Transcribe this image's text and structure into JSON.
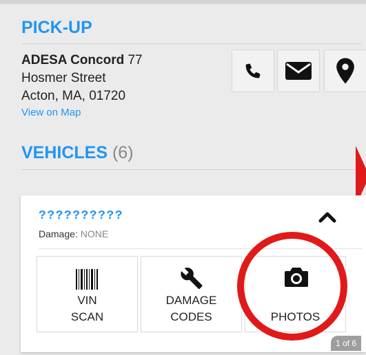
{
  "pickup": {
    "title": "PICK-UP",
    "location_name": "ADESA Concord",
    "address_line1_rest": "77",
    "address_line2": "Hosmer Street",
    "address_line3": "Acton, MA, 01720",
    "view_on_map": "View on Map",
    "actions": [
      {
        "icon": "phone-icon"
      },
      {
        "icon": "envelope-icon"
      },
      {
        "icon": "map-pin-icon"
      }
    ]
  },
  "vehicles": {
    "title": "VEHICLES",
    "count": "(6)"
  },
  "vehicle_card": {
    "vin": "??????????",
    "damage_label": "Damage:",
    "damage_value": "NONE",
    "tiles": [
      {
        "line1": "VIN",
        "line2": "SCAN",
        "icon": "barcode-icon"
      },
      {
        "line1": "DAMAGE",
        "line2": "CODES",
        "icon": "wrench-icon"
      },
      {
        "line1": "PHOTOS",
        "icon": "camera-icon"
      }
    ],
    "pager": "1 of 6"
  },
  "colors": {
    "accent": "#2196f3",
    "annotation_red": "#e01a1a"
  }
}
